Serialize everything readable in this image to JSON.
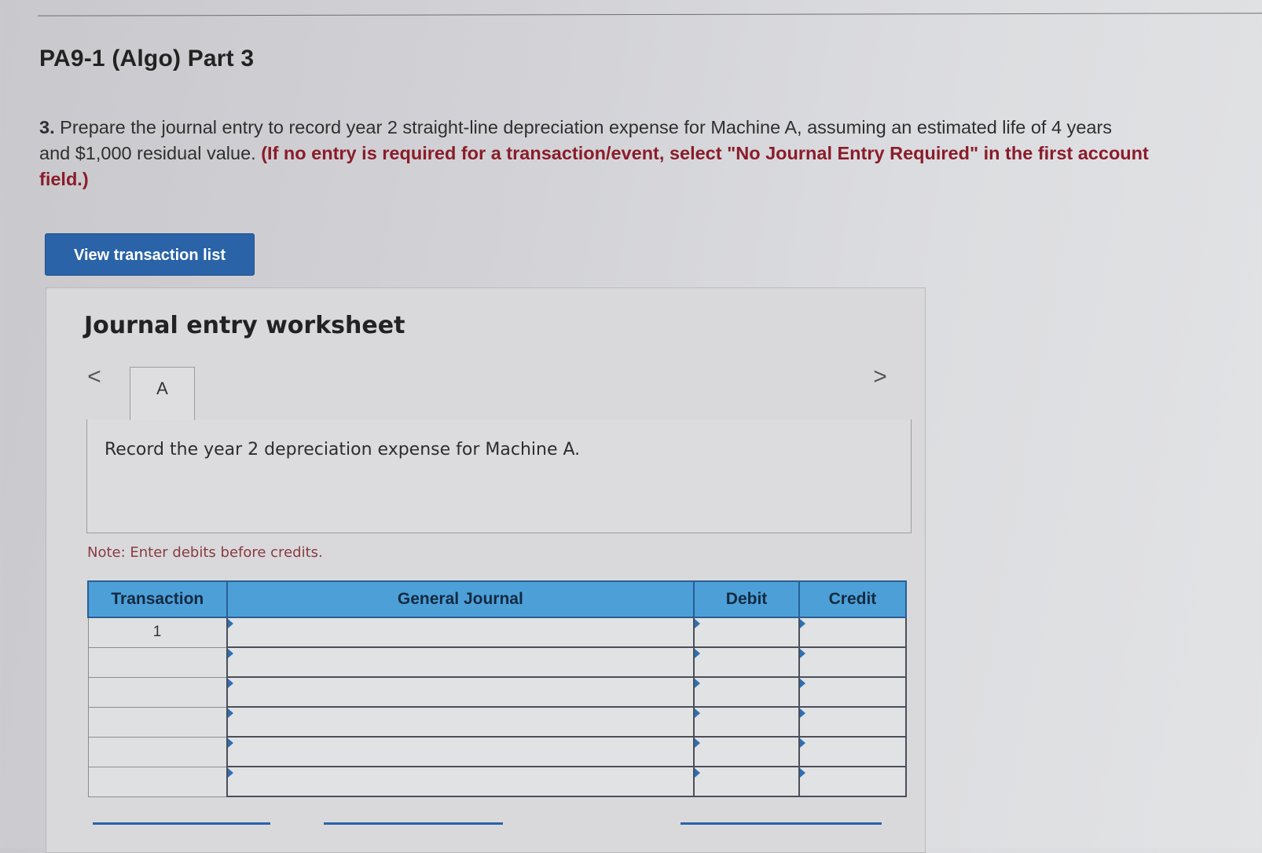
{
  "page": {
    "title": "PA9-1 (Algo) Part 3",
    "instruction_number": "3.",
    "instruction_line1": "Prepare the journal entry to record year 2 straight-line depreciation expense for Machine A, assuming an estimated life of 4 years",
    "instruction_line2": "and $1,000 residual value.",
    "instruction_emphasis_line2": "(If no entry is required for a transaction/event, select \"No Journal Entry Required\" in the first account",
    "instruction_emphasis_line3": "field.)",
    "view_button_label": "View transaction list"
  },
  "worksheet": {
    "title": "Journal entry worksheet",
    "prev_arrow": "<",
    "next_arrow": ">",
    "tabs": [
      {
        "label": "A"
      }
    ],
    "description": "Record the year 2 depreciation expense for Machine A.",
    "note": "Note: Enter debits before credits.",
    "table": {
      "headers": {
        "transaction": "Transaction",
        "general_journal": "General Journal",
        "debit": "Debit",
        "credit": "Credit"
      },
      "rows": [
        {
          "transaction": "1",
          "account": "",
          "debit": "",
          "credit": ""
        },
        {
          "transaction": "",
          "account": "",
          "debit": "",
          "credit": ""
        },
        {
          "transaction": "",
          "account": "",
          "debit": "",
          "credit": ""
        },
        {
          "transaction": "",
          "account": "",
          "debit": "",
          "credit": ""
        },
        {
          "transaction": "",
          "account": "",
          "debit": "",
          "credit": ""
        },
        {
          "transaction": "",
          "account": "",
          "debit": "",
          "credit": ""
        }
      ]
    }
  },
  "colors": {
    "button_blue": "#2a63a8",
    "header_blue": "#4d9fd8",
    "emphasis_red": "#8a1c2a"
  }
}
